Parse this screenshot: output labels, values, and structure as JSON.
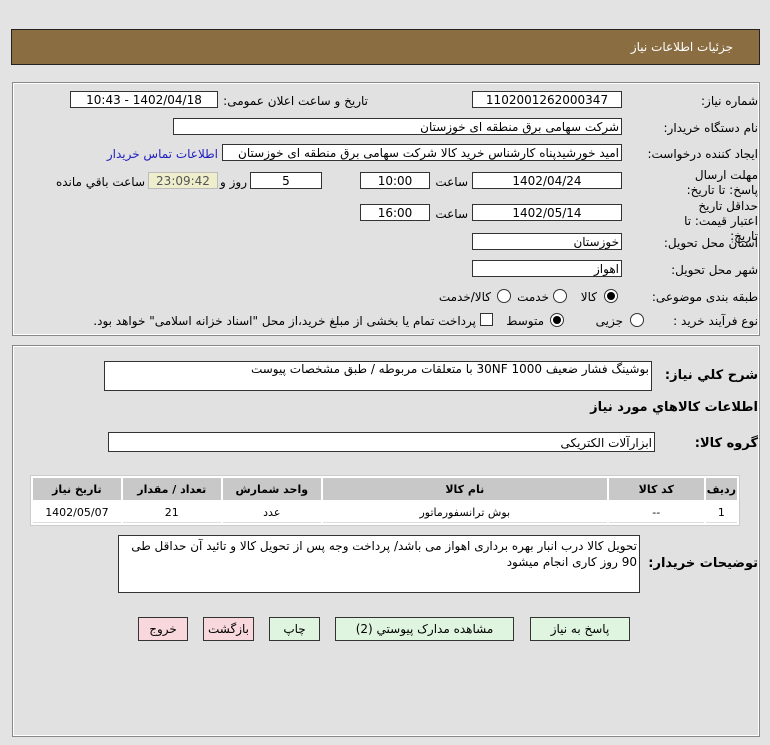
{
  "header": {
    "title": "جزئیات اطلاعات نیاز"
  },
  "form": {
    "need_number_label": "شماره نیاز:",
    "need_number": "1102001262000347",
    "announce_label": "تاریخ و ساعت اعلان عمومی:",
    "announce_value": "1402/04/18 - 10:43",
    "buyer_label": "نام دستگاه خریدار:",
    "buyer": "شرکت سهامی برق منطقه ای خوزستان",
    "creator_label": "ایجاد کننده درخواست:",
    "creator": "امید خورشیدپناه کارشناس خرید کالا شرکت سهامی برق منطقه ای خوزستان",
    "contact_link": "اطلاعات تماس خریدار",
    "deadline_label": "مهلت ارسال پاسخ: تا تاریخ:",
    "deadline_date": "1402/04/24",
    "time_label": "ساعت",
    "deadline_time": "10:00",
    "days": "5",
    "days_label": "روز و",
    "remaining": "23:09:42",
    "remaining_label": "ساعت باقي مانده",
    "validity_label": "حداقل تاریخ اعتبار قیمت: تا تاریخ:",
    "validity_date": "1402/05/14",
    "validity_time": "16:00",
    "province_label": "استان محل تحویل:",
    "province": "خوزستان",
    "city_label": "شهر محل تحویل:",
    "city": "اهواز",
    "category_label": "طبقه بندی موضوعی:",
    "category_options": [
      "کالا",
      "خدمت",
      "کالا/خدمت"
    ],
    "category_selected": "کالا",
    "process_label": "نوع فرآیند خرید :",
    "process_options": [
      "جزیی",
      "متوسط"
    ],
    "process_selected": "متوسط",
    "payment_note": "پرداخت تمام یا بخشی از مبلغ خرید،از محل \"اسناد خزانه اسلامی\" خواهد بود."
  },
  "details": {
    "summary_label": "شرح کلي نياز:",
    "summary": "بوشینگ فشار ضعیف  1000 30NF با متعلقات مربوطه / طبق مشخصات پیوست",
    "goods_info_title": "اطلاعات کالاهاي مورد نياز",
    "group_label": "گروه کالا:",
    "group": "ابزارآلات الکتریکی",
    "table": {
      "headers": [
        "ردیف",
        "کد کالا",
        "نام کالا",
        "واحد شمارش",
        "تعداد / مقدار",
        "تاریخ نیاز"
      ],
      "rows": [
        [
          "1",
          "--",
          "بوش ترانسفورماتور",
          "عدد",
          "21",
          "1402/05/07"
        ]
      ]
    },
    "notes_label": "توضیحات خریدار:",
    "notes": "تحویل کالا درب انبار بهره برداری اهواز می باشد/ پرداخت وجه پس از تحویل کالا و تائید آن حداقل طی 90 روز کاری انجام میشود"
  },
  "buttons": {
    "reply": "پاسخ به نیاز",
    "attachments": "مشاهده مدارک پیوستي (2)",
    "print": "چاپ",
    "back": "بازگشت",
    "exit": "خروج"
  },
  "colors": {
    "header": "#8b6d42",
    "remaining_bg": "#eeeecc",
    "green_button": "#dff5df",
    "red_button": "#f8d8dc",
    "link": "#2020c0"
  }
}
